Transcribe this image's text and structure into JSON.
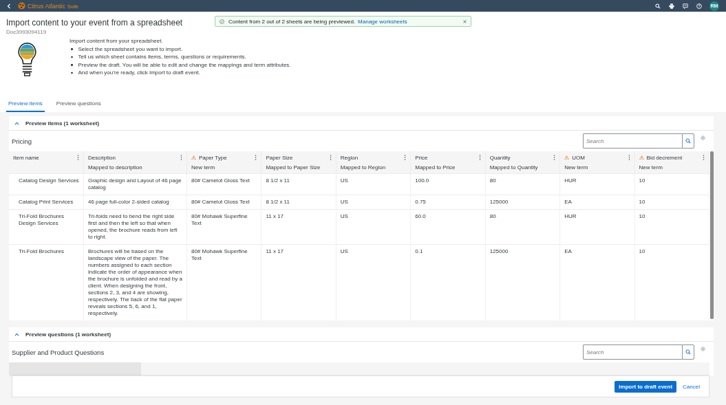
{
  "topbar": {
    "brand": "Citrus Atlantic",
    "brand_suffix": "Suite",
    "avatar": "RM"
  },
  "toast": {
    "message": "Content from 2 out of 2 sheets are being previewed.",
    "link": "Manage worksheets"
  },
  "header": {
    "title": "Import content to your event from a spreadsheet",
    "doc_id": "Doc3993094119"
  },
  "intro": {
    "heading": "Import content from your spreadsheet.",
    "bullets": [
      "Select the spreadsheet you want to import.",
      "Tell us which sheet contains items, terms, questions or requirements.",
      "Preview the draft. You will be able to edit and change the mappings and term attributes.",
      "And when you’re ready, click Import to draft event."
    ]
  },
  "tabs": [
    {
      "label": "Preview items",
      "selected": true
    },
    {
      "label": "Preview questions",
      "selected": false
    }
  ],
  "items_section": {
    "heading": "Preview items (1 worksheet)",
    "expanded": true,
    "table_title": "Pricing",
    "search_placeholder": "Search",
    "columns": [
      {
        "name": "Item name",
        "warning": false
      },
      {
        "name": "Description",
        "mapping": "Mapped to description",
        "warning": false
      },
      {
        "name": "Paper Type",
        "mapping": "New term",
        "warning": true
      },
      {
        "name": "Paper Size",
        "mapping": "Mapped to Paper Size",
        "warning": false
      },
      {
        "name": "Region",
        "mapping": "Mapped to Region",
        "warning": false
      },
      {
        "name": "Price",
        "mapping": "Mapped to Price",
        "warning": false
      },
      {
        "name": "Quantity",
        "mapping": "Mapped to Quantity",
        "warning": false
      },
      {
        "name": "UOM",
        "mapping": "New term",
        "warning": true
      },
      {
        "name": "Bid decrement",
        "mapping": "New term",
        "warning": true
      }
    ],
    "rows": [
      [
        "Catalog Design Services",
        "Graphic design and Layout of 46 page catalog",
        "80# Camelot Gloss Text",
        "8 1/2 x 11",
        "US",
        "100.0",
        "80",
        "HUR",
        "10"
      ],
      [
        "Catalog Print Services",
        "46 page full-color 2-sided catalog",
        "80# Camelot Gloss Text",
        "8 1/2 x 11",
        "US",
        "0.75",
        "125000",
        "EA",
        "10"
      ],
      [
        "Tri-Fold Brochures Design Services",
        "Tri-folds need to bend the right side first and then the left so that when opened, the brochure reads from left to right.",
        "80# Mohawk Superfine Text",
        "11 x 17",
        "US",
        "60.0",
        "80",
        "HUR",
        "10"
      ],
      [
        "Tri-Fold Brochures",
        "Brochures will be based on the landscape view of the paper. The numbers assigned to each section indicate the order of appearance when the brochure is unfolded and read by a client. When designing the front, sections 2, 3, and 4 are showing, respectively. The back of the flat paper reveals sections 5, 6, and 1, respectively.",
        "80# Mohawk Superfine Text",
        "11 x 17",
        "US",
        "0.1",
        "125000",
        "EA",
        "10"
      ]
    ]
  },
  "questions_section": {
    "heading": "Preview questions (1 worksheet)",
    "expanded": true,
    "table_title": "Supplier and Product Questions",
    "search_placeholder": "Search"
  },
  "footer": {
    "primary": "Import to draft event",
    "secondary": "Cancel"
  }
}
